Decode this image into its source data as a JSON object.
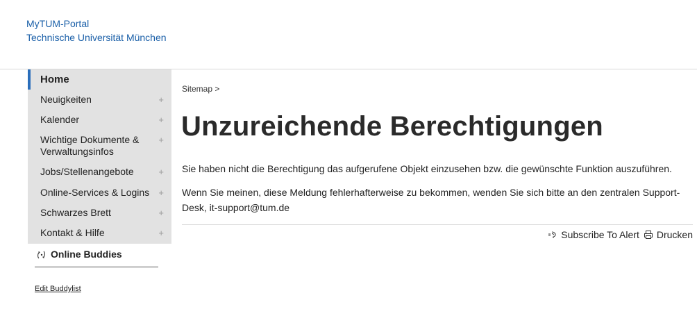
{
  "header": {
    "portal_name": "MyTUM-Portal",
    "university": "Technische Universität München"
  },
  "sidebar": {
    "items": [
      {
        "label": "Home",
        "active": true,
        "expandable": false
      },
      {
        "label": "Neuigkeiten",
        "expandable": true
      },
      {
        "label": "Kalender",
        "expandable": true
      },
      {
        "label": "Wichtige Dokumente & Verwaltungsinfos",
        "expandable": true
      },
      {
        "label": "Jobs/Stellenangebote",
        "expandable": true
      },
      {
        "label": "Online-Services & Logins",
        "expandable": true
      },
      {
        "label": "Schwarzes Brett",
        "expandable": true
      },
      {
        "label": "Kontakt & Hilfe",
        "expandable": true
      }
    ],
    "expand_symbol": "+",
    "buddies_label": "Online Buddies",
    "buddies_icon": "buddies-icon",
    "edit_buddylist": "Edit Buddylist"
  },
  "main": {
    "breadcrumb": "Sitemap >",
    "title": "Unzureichende Berechtigungen",
    "message1": "Sie haben nicht die Berechtigung das aufgerufene Objekt einzusehen bzw. die gewünschte Funktion auszuführen.",
    "message2": "Wenn Sie meinen, diese Meldung fehlerhafterweise zu bekommen, wenden Sie sich bitte an den zentralen Support-Desk, it-support@tum.de"
  },
  "actions": {
    "subscribe_label": "Subscribe To Alert",
    "print_label": "Drucken"
  },
  "colors": {
    "accent": "#2a6ebb",
    "link": "#1a5fa8",
    "sidebar_bg": "#e2e2e2"
  }
}
